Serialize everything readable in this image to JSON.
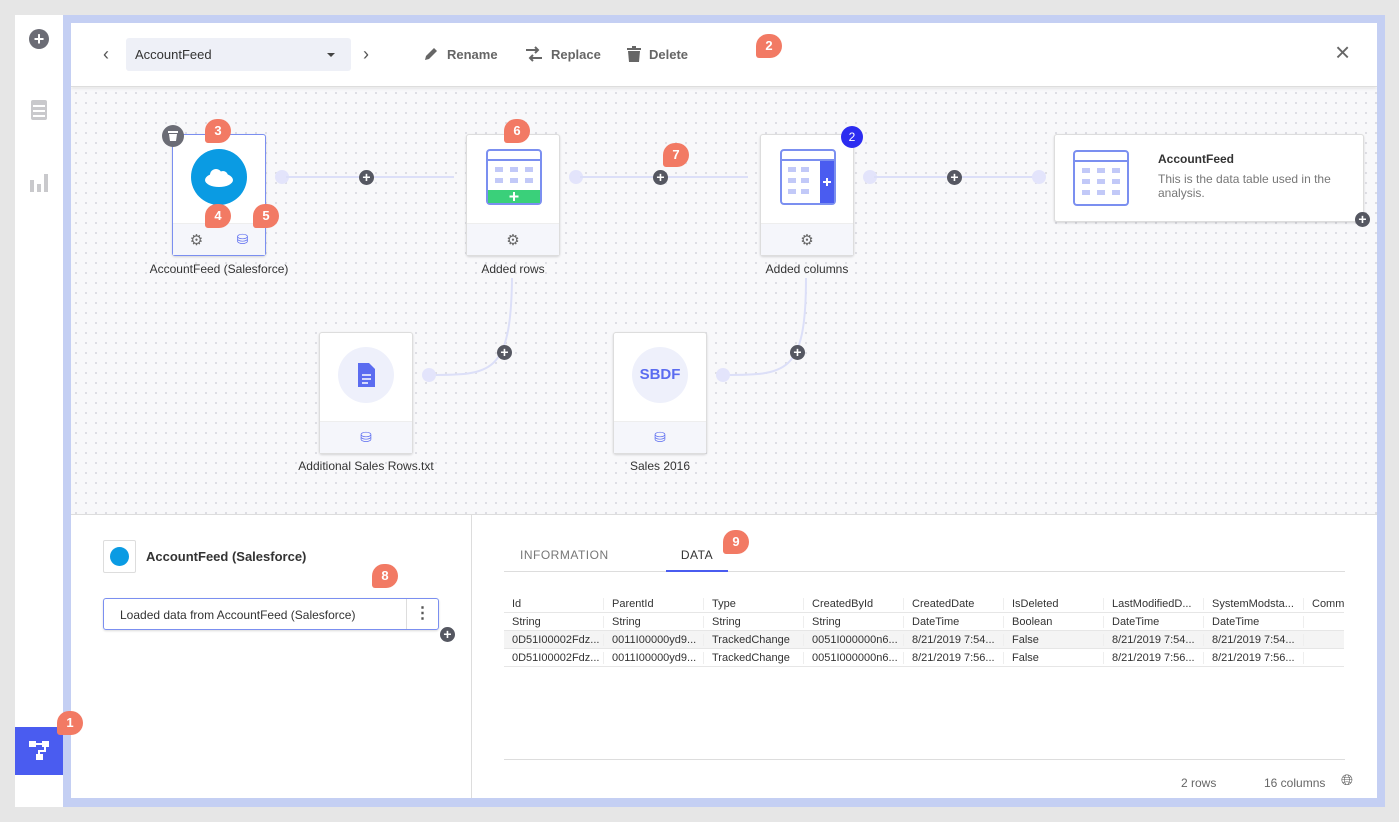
{
  "sidebar": {
    "items": [
      {
        "icon": "add-icon"
      },
      {
        "icon": "document-icon"
      },
      {
        "icon": "bar-chart-icon"
      },
      {
        "icon": "data-canvas-icon"
      }
    ]
  },
  "header": {
    "source_select": "AccountFeed",
    "rename": "Rename",
    "replace": "Replace",
    "delete": "Delete"
  },
  "nodes": {
    "source": {
      "label": "AccountFeed (Salesforce)"
    },
    "added_rows": {
      "label": "Added rows"
    },
    "added_columns": {
      "label": "Added columns",
      "count_badge": "2"
    },
    "result": {
      "title": "AccountFeed",
      "description": "This is the data table used in the analysis."
    },
    "additional": {
      "label": "Additional Sales Rows.txt"
    },
    "sales": {
      "label": "Sales 2016",
      "icon_text": "SBDF"
    }
  },
  "callouts": [
    "1",
    "2",
    "3",
    "4",
    "5",
    "6",
    "7",
    "8",
    "9"
  ],
  "details": {
    "title": "AccountFeed (Salesforce)",
    "step": "Loaded data from AccountFeed (Salesforce)"
  },
  "tabs": [
    {
      "label": "INFORMATION",
      "active": false
    },
    {
      "label": "DATA",
      "active": true
    }
  ],
  "table": {
    "headers": [
      "Id",
      "ParentId",
      "Type",
      "CreatedById",
      "CreatedDate",
      "IsDeleted",
      "LastModifiedD...",
      "SystemModsta...",
      "Comm"
    ],
    "types": [
      "String",
      "String",
      "String",
      "String",
      "DateTime",
      "Boolean",
      "DateTime",
      "DateTime",
      ""
    ],
    "rows": [
      [
        "0D51I00002Fdz...",
        "0011I00000yd9...",
        "TrackedChange",
        "0051I000000n6...",
        "8/21/2019 7:54...",
        "False",
        "8/21/2019 7:54...",
        "8/21/2019 7:54...",
        ""
      ],
      [
        "0D51I00002Fdz...",
        "0011I00000yd9...",
        "TrackedChange",
        "0051I000000n6...",
        "8/21/2019 7:56...",
        "False",
        "8/21/2019 7:56...",
        "8/21/2019 7:56...",
        ""
      ]
    ]
  },
  "footer": {
    "rows": "2 rows",
    "columns": "16 columns"
  },
  "colors": {
    "accent": "#4a5cf0",
    "callout": "#f27a64",
    "salesforce": "#0a9be3",
    "frame": "#c4cff3"
  }
}
